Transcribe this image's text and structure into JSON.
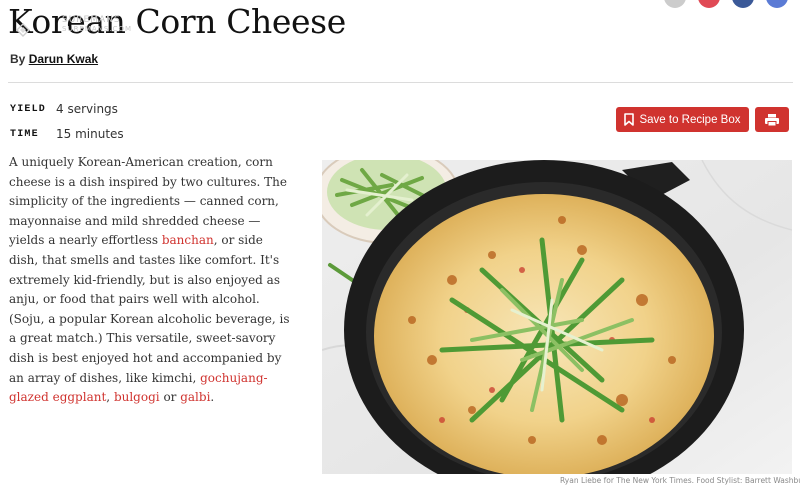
{
  "recipe": {
    "title": "Korean Corn Cheese",
    "byline_prefix": "By",
    "author": "Darun Kwak",
    "yield_label": "YIELD",
    "yield_value": "4 servings",
    "time_label": "TIME",
    "time_value": "15 minutes"
  },
  "watermark": {
    "line1": "SUREMANS",
    "line2": "SUREMANS.COM"
  },
  "actions": {
    "save_label": "Save to Recipe Box",
    "save_icon": "bookmark-icon",
    "print_icon": "printer-icon"
  },
  "intro": {
    "part1": "A uniquely Korean-American creation, corn cheese is a dish inspired by two cultures. The simplicity of the ingredients — canned corn, mayonnaise and mild shredded cheese — yields a nearly effortless ",
    "link1": "banchan",
    "part2": ", or side dish, that smells and tastes like comfort. It's extremely kid-friendly, but is also enjoyed as anju, or food that pairs well with alcohol. (Soju, a popular Korean alcoholic beverage, is a great match.) This versatile, sweet-savory dish is best enjoyed hot and accompanied by an array of dishes, like kimchi, ",
    "link2": "gochujang-glazed eggplant",
    "part3": ", ",
    "link3": "bulgogi",
    "part4": " or ",
    "link4": "galbi",
    "part5": "."
  },
  "photo": {
    "credit": "Ryan Liebe for The New York Times. Food Stylist: Barrett Washburne."
  },
  "colors": {
    "accent": "#d0332f",
    "title": "#121212",
    "body": "#333333",
    "divider": "#dcdcdc",
    "share_circles": [
      "#cccccc",
      "#e04a55",
      "#3b5998",
      "#5b7bd5"
    ]
  }
}
